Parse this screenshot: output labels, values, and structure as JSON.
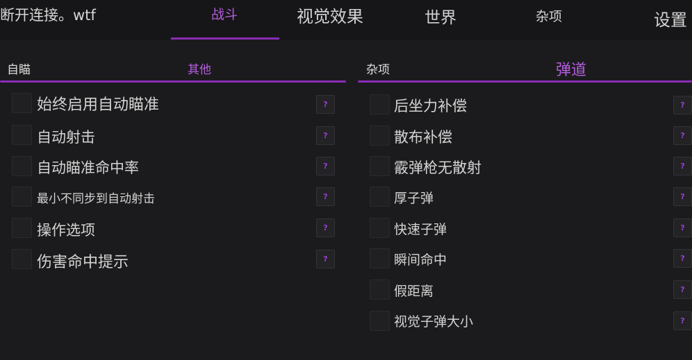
{
  "status_text": "断开连接。wtf",
  "top_tabs": [
    {
      "label": "战斗",
      "active": true
    },
    {
      "label": "视觉效果",
      "active": false
    },
    {
      "label": "世界",
      "active": false
    },
    {
      "label": "杂项",
      "active": false
    },
    {
      "label": "设置",
      "active": false
    }
  ],
  "left_panel": {
    "subtabs": [
      {
        "label": "自瞄",
        "active": false
      },
      {
        "label": "其他",
        "active": true
      }
    ],
    "options": [
      {
        "label": "始终启用自动瞄准",
        "checked": false
      },
      {
        "label": "自动射击",
        "checked": false
      },
      {
        "label": "自动瞄准命中率",
        "checked": false
      },
      {
        "label": "最小不同步到自动射击",
        "checked": false
      },
      {
        "label": "操作选项",
        "checked": false
      },
      {
        "label": "伤害命中提示",
        "checked": false
      }
    ]
  },
  "right_panel": {
    "subtabs": [
      {
        "label": "杂项",
        "active": false
      },
      {
        "label": "弹道",
        "active": true
      }
    ],
    "options": [
      {
        "label": "后坐力补偿",
        "checked": false
      },
      {
        "label": "散布补偿",
        "checked": false
      },
      {
        "label": "霰弹枪无散射",
        "checked": false
      },
      {
        "label": "厚子弹",
        "checked": false
      },
      {
        "label": "快速子弹",
        "checked": false
      },
      {
        "label": "瞬间命中",
        "checked": false
      },
      {
        "label": "假距离",
        "checked": false
      },
      {
        "label": "视觉子弹大小",
        "checked": false
      }
    ]
  },
  "help_glyph": "?",
  "colors": {
    "accent": "#8a2bb8",
    "accent_text": "#b65de0",
    "background": "#1b1b1d",
    "topbar": "#161618"
  }
}
